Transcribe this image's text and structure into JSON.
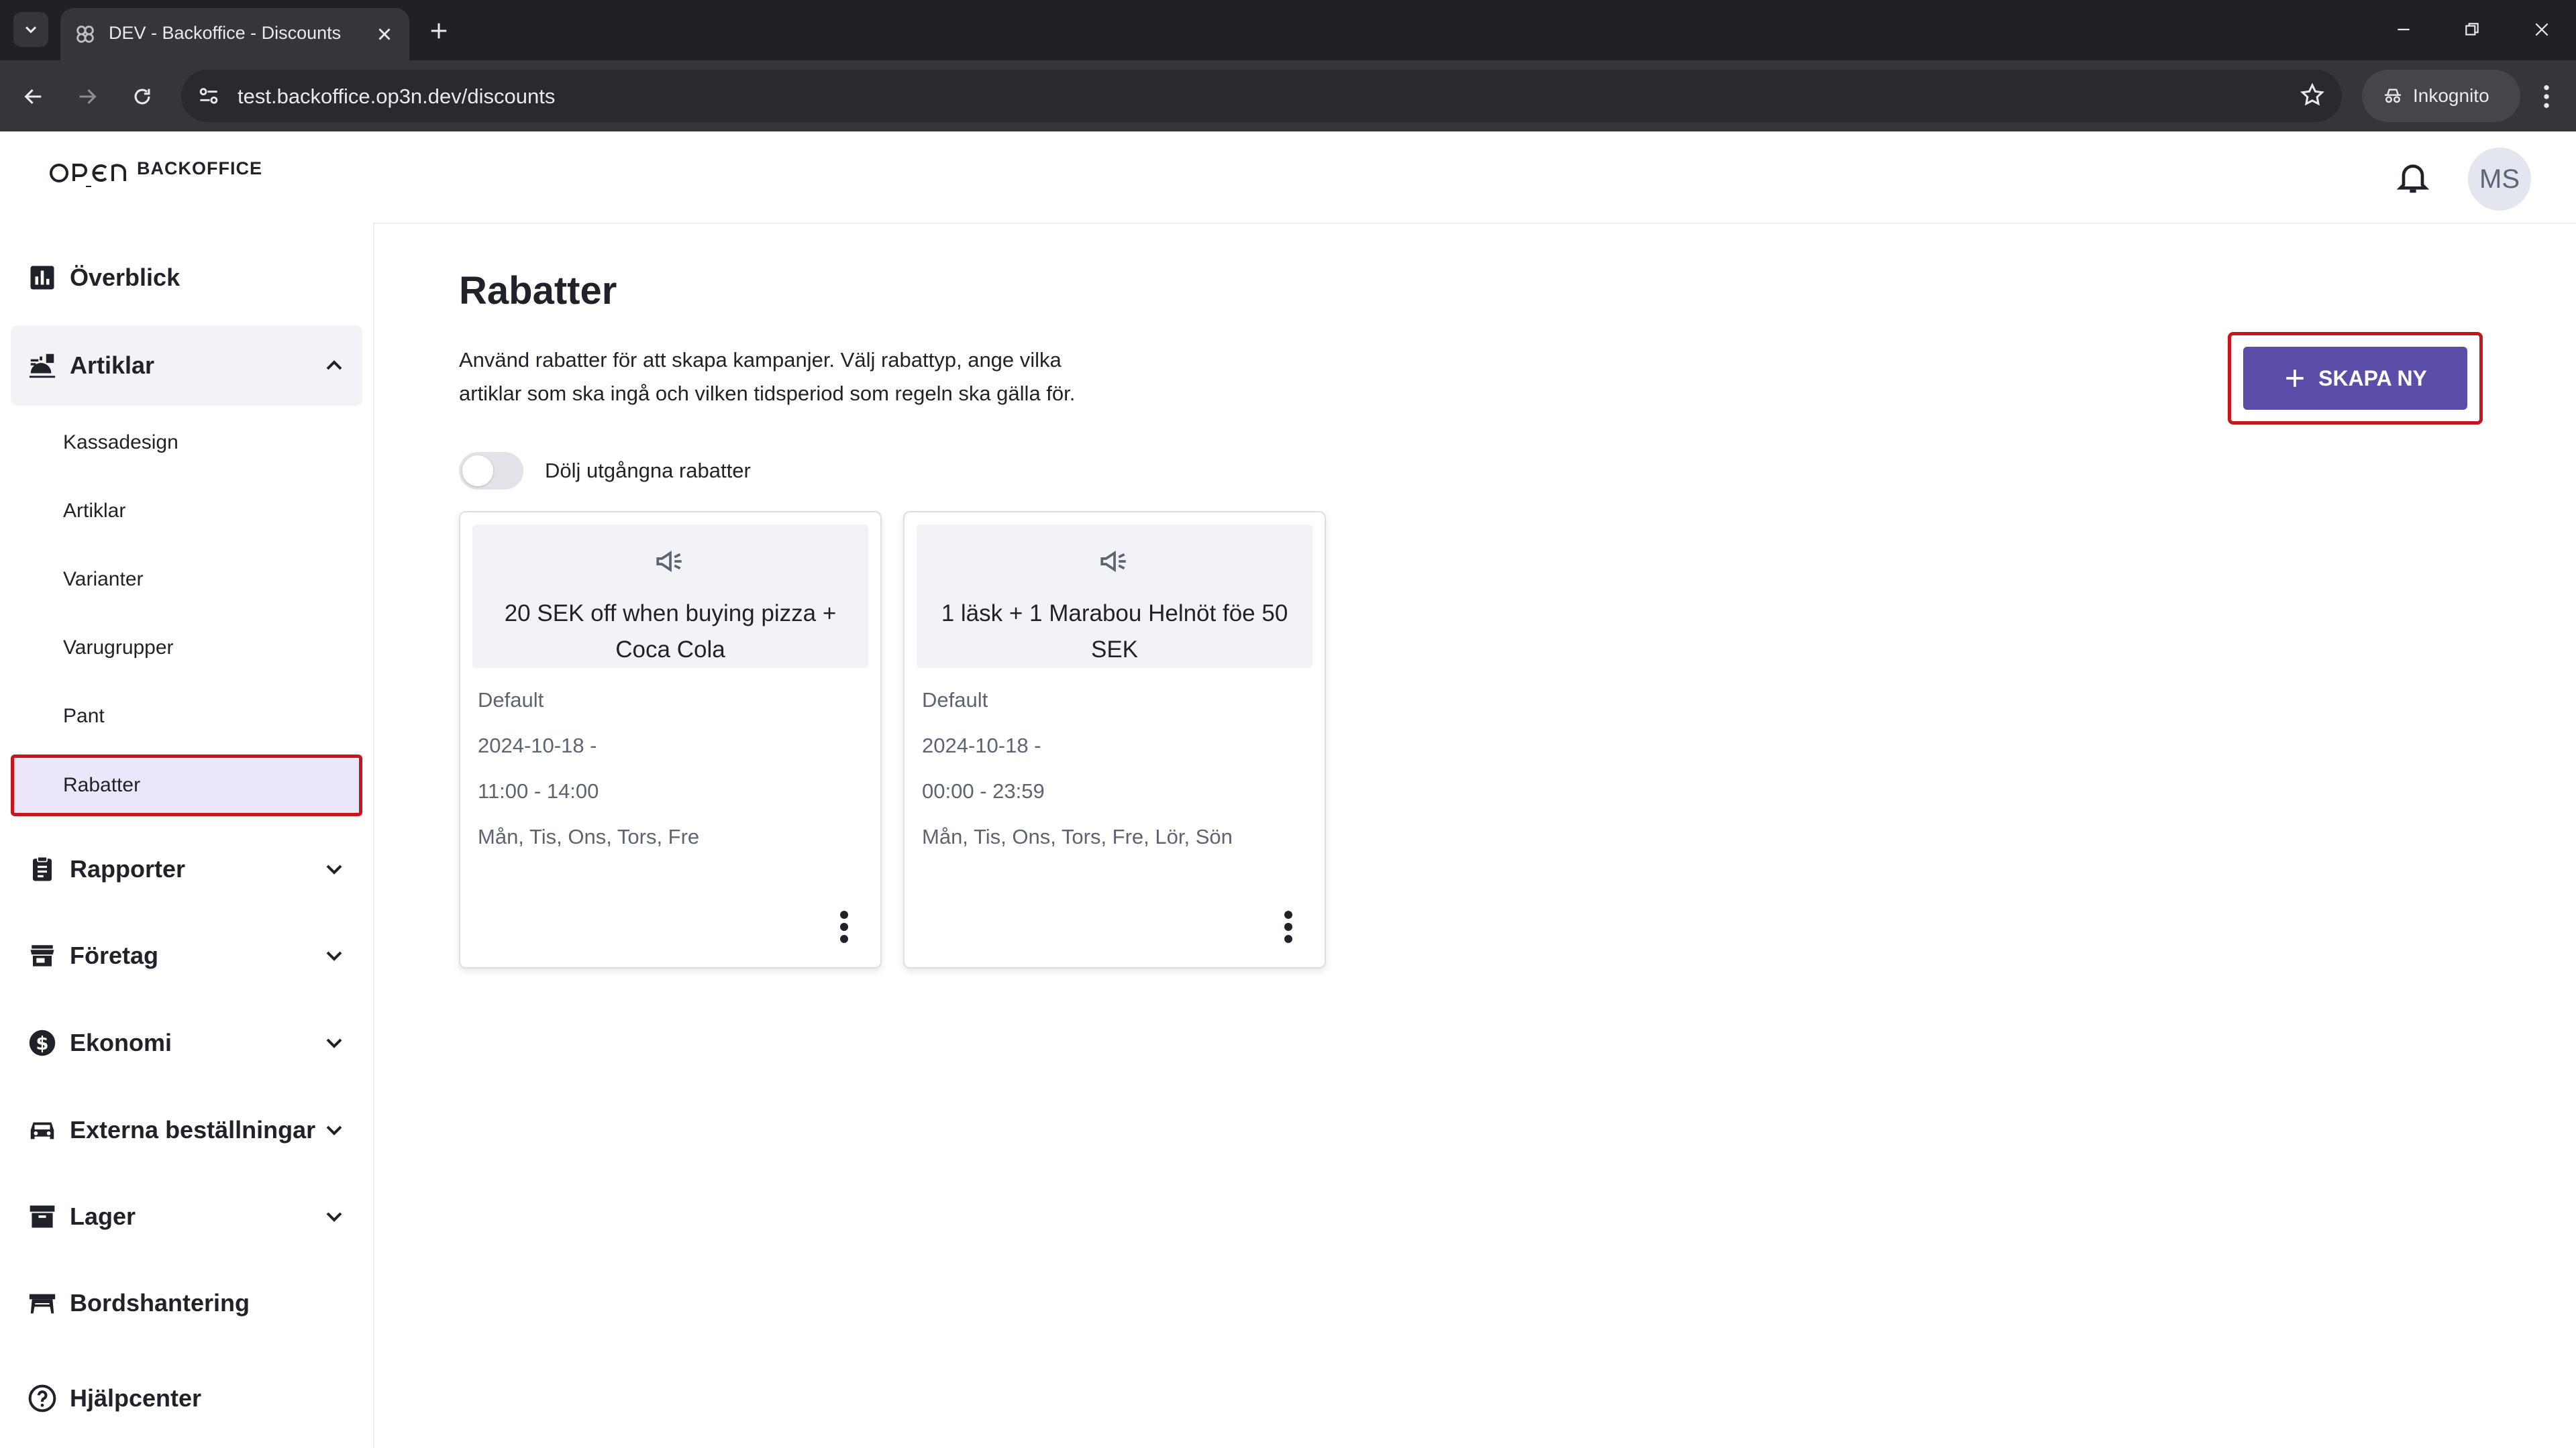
{
  "browser": {
    "tab_title": "DEV - Backoffice - Discounts",
    "url": "test.backoffice.op3n.dev/discounts",
    "incognito_label": "Inkognito"
  },
  "header": {
    "logo_text": "BACKOFFICE",
    "avatar_initials": "MS"
  },
  "sidebar": {
    "items": [
      {
        "label": "Överblick",
        "icon": "chart-icon"
      },
      {
        "label": "Artiklar",
        "icon": "articles-icon",
        "expanded": true
      },
      {
        "label": "Rapporter",
        "icon": "clipboard-icon"
      },
      {
        "label": "Företag",
        "icon": "store-icon"
      },
      {
        "label": "Ekonomi",
        "icon": "dollar-icon"
      },
      {
        "label": "Externa beställningar",
        "icon": "car-icon"
      },
      {
        "label": "Lager",
        "icon": "archive-icon"
      },
      {
        "label": "Bordshantering",
        "icon": "table-icon"
      },
      {
        "label": "Hjälpcenter",
        "icon": "help-icon"
      }
    ],
    "sub_items": [
      "Kassadesign",
      "Artiklar",
      "Varianter",
      "Varugrupper",
      "Pant",
      "Rabatter"
    ],
    "active_sub_item": "Rabatter"
  },
  "main": {
    "title": "Rabatter",
    "description": "Använd rabatter för att skapa kampanjer. Välj rabattyp, ange vilka artiklar som ska ingå och vilken tidsperiod som regeln ska gälla för.",
    "create_button": "SKAPA NY",
    "toggle_label": "Dölj utgångna rabatter",
    "toggle_on": false,
    "cards": [
      {
        "title": "20 SEK off when buying pizza + Coca Cola",
        "group": "Default",
        "date": "2024-10-18 -",
        "time": "11:00 - 14:00",
        "days": "Mån, Tis, Ons, Tors, Fre"
      },
      {
        "title": "1 läsk + 1 Marabou Helnöt föe 50 SEK",
        "group": "Default",
        "date": "2024-10-18 -",
        "time": "00:00 - 23:59",
        "days": "Mån, Tis, Ons, Tors, Fre, Lör, Sön"
      }
    ]
  },
  "colors": {
    "accent": "#5b4ea8",
    "highlight_border": "#c5151e",
    "active_bg": "#ece6fb"
  }
}
